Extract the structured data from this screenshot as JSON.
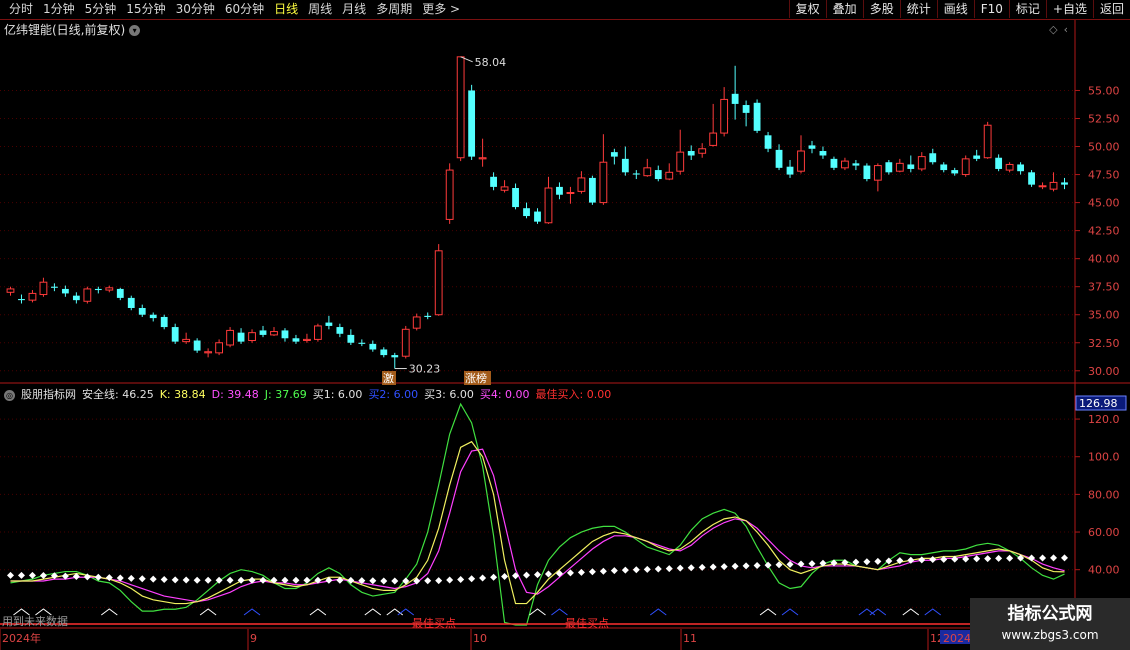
{
  "toolbar": {
    "periods": [
      "分时",
      "1分钟",
      "5分钟",
      "15分钟",
      "30分钟",
      "60分钟",
      "日线",
      "周线",
      "月线",
      "多周期",
      "更多 >"
    ],
    "active": "日线",
    "buttons": [
      "复权",
      "叠加",
      "多股",
      "统计",
      "画线",
      "F10",
      "标记",
      "+自选",
      "返回"
    ]
  },
  "stock": {
    "title": "亿纬锂能(日线,前复权)"
  },
  "colors": {
    "up": "#ff3b3b",
    "down": "#54ffff",
    "axis": "#b01818",
    "grid": "#5a0000"
  },
  "price_axis": {
    "ticks": [
      "55.00",
      "52.50",
      "50.00",
      "47.50",
      "45.00",
      "42.50",
      "40.00",
      "37.50",
      "35.00",
      "32.50",
      "30.00"
    ]
  },
  "markers": {
    "high": "58.04",
    "low": "30.23",
    "tag1": "激",
    "tag2": "涨榜"
  },
  "indicator": {
    "name": "股朋指标网",
    "safe_line": "安全线: 46.25",
    "k": "K: 38.84",
    "d": "D: 39.48",
    "j": "J: 37.69",
    "buy1": "买1: 6.00",
    "buy2": "买2: 6.00",
    "buy3": "买3: 6.00",
    "buy4": "买4: 0.00",
    "best_buy": "最佳买入: 0.00",
    "current_label": "126.98",
    "ticks": [
      "120.0",
      "100.0",
      "80.00",
      "60.00",
      "40.00",
      "20.00"
    ],
    "future_text": "用到未来数据",
    "best_buy_tag": "最佳买点"
  },
  "dates": [
    "2024年",
    "9",
    "10",
    "11",
    "12",
    "2024/"
  ],
  "watermark": {
    "line1": "指标公式网",
    "line2": "www.zbgs3.com"
  },
  "chart_data": {
    "type": "candlestick",
    "candles": [
      [
        37.0,
        37.3,
        37.5,
        36.7
      ],
      [
        36.4,
        36.3,
        36.8,
        36.0
      ],
      [
        36.3,
        36.9,
        37.2,
        36.1
      ],
      [
        36.8,
        37.9,
        38.3,
        36.6
      ],
      [
        37.5,
        37.4,
        37.8,
        37.1
      ],
      [
        37.3,
        36.9,
        37.6,
        36.6
      ],
      [
        36.7,
        36.3,
        37.0,
        36.0
      ],
      [
        36.2,
        37.3,
        37.5,
        36.0
      ],
      [
        37.3,
        37.2,
        37.5,
        36.9
      ],
      [
        37.2,
        37.4,
        37.6,
        37.0
      ],
      [
        37.3,
        36.5,
        37.4,
        36.3
      ],
      [
        36.5,
        35.6,
        36.7,
        35.4
      ],
      [
        35.6,
        35.0,
        35.9,
        34.8
      ],
      [
        35.0,
        34.7,
        35.2,
        34.4
      ],
      [
        34.8,
        33.9,
        35.0,
        33.7
      ],
      [
        33.9,
        32.6,
        34.2,
        32.4
      ],
      [
        32.6,
        32.8,
        33.4,
        32.4
      ],
      [
        32.7,
        31.8,
        32.9,
        31.6
      ],
      [
        31.6,
        31.7,
        32.0,
        31.2
      ],
      [
        31.6,
        32.5,
        32.8,
        31.4
      ],
      [
        32.3,
        33.6,
        33.9,
        32.1
      ],
      [
        33.4,
        32.6,
        33.8,
        32.4
      ],
      [
        32.7,
        33.4,
        33.7,
        32.5
      ],
      [
        33.6,
        33.2,
        34.0,
        33.0
      ],
      [
        33.2,
        33.5,
        33.9,
        33.1
      ],
      [
        33.6,
        32.9,
        33.8,
        32.6
      ],
      [
        32.9,
        32.6,
        33.2,
        32.4
      ],
      [
        32.7,
        32.8,
        33.3,
        32.5
      ],
      [
        32.8,
        34.0,
        34.2,
        32.6
      ],
      [
        34.3,
        34.0,
        34.9,
        33.7
      ],
      [
        33.9,
        33.3,
        34.2,
        33.0
      ],
      [
        33.2,
        32.5,
        33.7,
        32.3
      ],
      [
        32.5,
        32.4,
        32.8,
        32.2
      ],
      [
        32.4,
        31.9,
        32.7,
        31.7
      ],
      [
        31.9,
        31.4,
        32.1,
        31.2
      ],
      [
        31.4,
        31.2,
        31.6,
        30.2
      ],
      [
        31.3,
        33.7,
        34.0,
        31.1
      ],
      [
        33.8,
        34.8,
        35.1,
        33.6
      ],
      [
        34.9,
        34.8,
        35.2,
        34.6
      ],
      [
        35.0,
        40.7,
        41.3,
        34.9
      ],
      [
        43.5,
        47.9,
        48.5,
        43.1
      ],
      [
        49.0,
        58.0,
        58.0,
        48.7
      ],
      [
        55.0,
        49.1,
        55.5,
        48.8
      ],
      [
        48.9,
        49.0,
        50.7,
        48.2
      ],
      [
        47.3,
        46.4,
        47.7,
        46.1
      ],
      [
        46.1,
        46.4,
        47.0,
        45.9
      ],
      [
        46.3,
        44.6,
        46.7,
        44.4
      ],
      [
        44.5,
        43.8,
        45.0,
        43.6
      ],
      [
        44.2,
        43.3,
        44.5,
        43.1
      ],
      [
        43.2,
        46.3,
        47.3,
        43.1
      ],
      [
        46.4,
        45.7,
        46.8,
        45.3
      ],
      [
        45.9,
        45.9,
        46.4,
        44.9
      ],
      [
        46.0,
        47.2,
        47.8,
        45.8
      ],
      [
        47.2,
        45.0,
        47.4,
        44.8
      ],
      [
        45.0,
        48.6,
        51.1,
        44.8
      ],
      [
        49.5,
        49.1,
        49.8,
        48.4
      ],
      [
        48.9,
        47.7,
        50.0,
        47.4
      ],
      [
        47.6,
        47.5,
        47.9,
        47.1
      ],
      [
        47.4,
        48.1,
        48.9,
        47.3
      ],
      [
        47.9,
        47.1,
        48.3,
        46.9
      ],
      [
        47.1,
        47.7,
        48.5,
        47.0
      ],
      [
        47.8,
        49.5,
        51.5,
        47.5
      ],
      [
        49.6,
        49.2,
        50.1,
        48.8
      ],
      [
        49.4,
        49.8,
        50.3,
        49.0
      ],
      [
        50.1,
        51.2,
        53.8,
        50.0
      ],
      [
        51.2,
        54.2,
        55.3,
        50.9
      ],
      [
        54.7,
        53.8,
        57.2,
        52.4
      ],
      [
        53.7,
        53.0,
        54.1,
        51.8
      ],
      [
        53.9,
        51.4,
        54.2,
        51.2
      ],
      [
        51.0,
        49.8,
        51.3,
        49.5
      ],
      [
        49.7,
        48.1,
        50.2,
        47.9
      ],
      [
        48.2,
        47.5,
        48.8,
        47.2
      ],
      [
        47.8,
        49.6,
        51.0,
        47.6
      ],
      [
        50.1,
        49.8,
        50.5,
        49.4
      ],
      [
        49.6,
        49.2,
        50.0,
        48.9
      ],
      [
        48.9,
        48.1,
        49.1,
        47.9
      ],
      [
        48.1,
        48.7,
        49.0,
        47.9
      ],
      [
        48.5,
        48.3,
        48.8,
        47.9
      ],
      [
        48.3,
        47.1,
        48.5,
        46.9
      ],
      [
        47.0,
        48.3,
        48.5,
        46.0
      ],
      [
        48.6,
        47.7,
        48.8,
        47.5
      ],
      [
        47.8,
        48.5,
        48.9,
        47.7
      ],
      [
        48.4,
        48.0,
        49.2,
        47.7
      ],
      [
        48.0,
        49.1,
        49.5,
        47.8
      ],
      [
        49.4,
        48.6,
        49.8,
        48.4
      ],
      [
        48.4,
        47.9,
        48.6,
        47.7
      ],
      [
        47.9,
        47.6,
        48.1,
        47.4
      ],
      [
        47.5,
        48.9,
        49.2,
        47.3
      ],
      [
        49.2,
        48.9,
        49.7,
        48.7
      ],
      [
        49.0,
        51.9,
        52.2,
        48.9
      ],
      [
        49.0,
        48.0,
        49.3,
        47.8
      ],
      [
        47.9,
        48.4,
        48.6,
        47.7
      ],
      [
        48.4,
        47.8,
        48.6,
        47.5
      ],
      [
        47.7,
        46.6,
        47.9,
        46.4
      ],
      [
        46.5,
        46.5,
        46.8,
        46.2
      ],
      [
        46.2,
        46.8,
        47.7,
        46.0
      ],
      [
        46.8,
        46.6,
        47.2,
        46.2
      ]
    ],
    "y_range": [
      29.0,
      59.5
    ],
    "high_label": 58.04,
    "low_label": 30.23,
    "indicator_series": {
      "ylim": [
        17,
        128
      ],
      "safe_line": [
        37.0,
        37.0,
        37.0,
        36.9,
        36.8,
        36.6,
        36.4,
        36.2,
        36.0,
        35.8,
        35.6,
        35.4,
        35.2,
        35.0,
        34.8,
        34.6,
        34.5,
        34.4,
        34.4,
        34.4,
        34.4,
        34.4,
        34.4,
        34.4,
        34.4,
        34.4,
        34.4,
        34.4,
        34.4,
        34.4,
        34.4,
        34.3,
        34.2,
        34.1,
        34.0,
        34.0,
        34.0,
        34.0,
        34.1,
        34.2,
        34.5,
        34.8,
        35.2,
        35.6,
        36.0,
        36.4,
        36.8,
        37.1,
        37.4,
        37.7,
        38.0,
        38.3,
        38.6,
        38.9,
        39.2,
        39.5,
        39.8,
        40.0,
        40.2,
        40.4,
        40.6,
        40.8,
        41.0,
        41.2,
        41.4,
        41.6,
        41.8,
        42.0,
        42.2,
        42.4,
        42.6,
        42.8,
        43.0,
        43.2,
        43.4,
        43.6,
        43.8,
        44.0,
        44.2,
        44.4,
        44.6,
        44.8,
        45.0,
        45.2,
        45.4,
        45.5,
        45.6,
        45.7,
        45.8,
        45.9,
        46.0,
        46.1,
        46.2,
        46.2,
        46.2,
        46.3,
        46.25
      ],
      "k": [
        34,
        34,
        34,
        35,
        36,
        37,
        38,
        37,
        36,
        35,
        33,
        30,
        26,
        24,
        23,
        22,
        22,
        23,
        25,
        28,
        31,
        34,
        35,
        35,
        33,
        32,
        31,
        32,
        34,
        36,
        36,
        34,
        32,
        30,
        29,
        29,
        32,
        36,
        45,
        62,
        85,
        105,
        108,
        100,
        80,
        45,
        22,
        22,
        28,
        35,
        40,
        45,
        50,
        55,
        58,
        60,
        59,
        57,
        55,
        52,
        50,
        51,
        55,
        60,
        64,
        67,
        68,
        66,
        60,
        53,
        45,
        40,
        38,
        40,
        42,
        43,
        43,
        42,
        41,
        40,
        42,
        44,
        45,
        46,
        46,
        47,
        47,
        48,
        49,
        50,
        51,
        50,
        48,
        45,
        41,
        39,
        38.84
      ],
      "d": [
        34,
        34,
        34,
        34,
        35,
        35,
        36,
        36,
        36,
        35,
        34,
        32,
        30,
        28,
        26,
        25,
        24,
        23,
        24,
        26,
        28,
        31,
        33,
        34,
        33,
        33,
        32,
        32,
        33,
        34,
        35,
        34,
        33,
        32,
        31,
        30,
        31,
        33,
        38,
        50,
        70,
        92,
        103,
        104,
        90,
        65,
        40,
        28,
        27,
        31,
        36,
        41,
        46,
        51,
        55,
        58,
        58,
        57,
        55,
        53,
        51,
        50,
        53,
        58,
        62,
        65,
        67,
        66,
        62,
        56,
        50,
        45,
        42,
        41,
        42,
        42,
        42,
        42,
        41,
        40,
        41,
        42,
        44,
        45,
        45,
        46,
        46,
        47,
        48,
        49,
        50,
        50,
        48,
        46,
        43,
        41,
        39.48
      ],
      "j": [
        33,
        34,
        35,
        37,
        38,
        39,
        39,
        37,
        34,
        33,
        29,
        23,
        18,
        18,
        19,
        19,
        20,
        24,
        29,
        34,
        38,
        40,
        39,
        37,
        33,
        30,
        30,
        33,
        38,
        41,
        38,
        32,
        28,
        26,
        27,
        28,
        35,
        43,
        60,
        85,
        112,
        128,
        118,
        95,
        58,
        12,
        -5,
        8,
        32,
        45,
        52,
        57,
        60,
        62,
        63,
        63,
        60,
        56,
        52,
        50,
        48,
        53,
        61,
        67,
        70,
        72,
        70,
        63,
        52,
        42,
        33,
        30,
        31,
        38,
        43,
        45,
        45,
        42,
        41,
        40,
        45,
        49,
        48,
        48,
        49,
        50,
        50,
        51,
        53,
        54,
        53,
        50,
        46,
        41,
        37,
        35,
        37.69
      ]
    }
  }
}
